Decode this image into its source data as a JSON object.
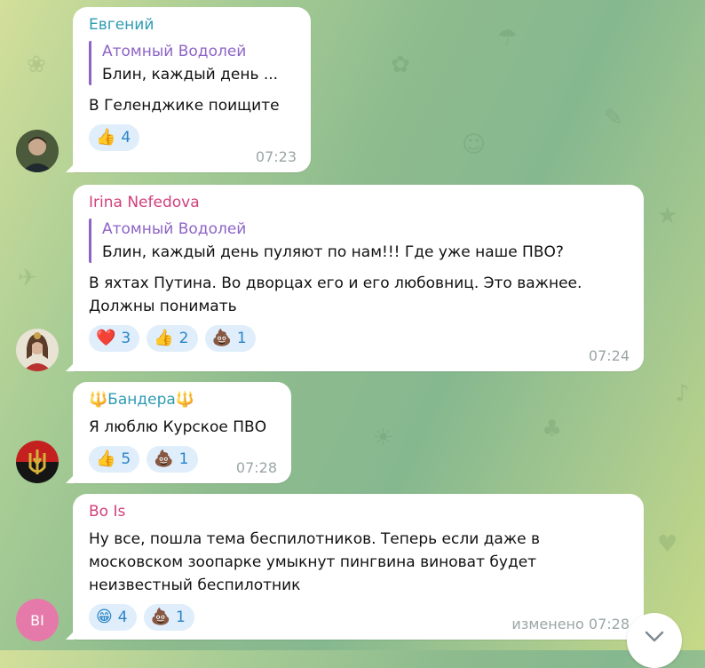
{
  "messages": [
    {
      "sender": "Евгений",
      "sender_color": "#2e9bb3",
      "quote": {
        "author": "Атомный Водолей",
        "text": "Блин,  каждый день ..."
      },
      "text_lines": [
        "В Геленджике поищите"
      ],
      "reactions": [
        {
          "emoji": "👍",
          "count": "4"
        }
      ],
      "time": "07:23"
    },
    {
      "sender": "Irina Nefedova",
      "sender_color": "#d0417c",
      "quote": {
        "author": "Атомный Водолей",
        "text": "Блин,  каждый день пуляют по нам!!! Где уже наше ПВО?"
      },
      "text_lines": [
        "В яхтах Путина. Во дворцах его и его любовниц. Это важнее.",
        "Должны понимать"
      ],
      "reactions": [
        {
          "emoji": "❤️",
          "count": "3"
        },
        {
          "emoji": "👍",
          "count": "2"
        },
        {
          "emoji": "💩",
          "count": "1"
        }
      ],
      "time": "07:24"
    },
    {
      "sender": "🔱Бандера🔱",
      "sender_color": "#2e9bb3",
      "text_lines": [
        "Я люблю Курское ПВО"
      ],
      "reactions": [
        {
          "emoji": "👍",
          "count": "5"
        },
        {
          "emoji": "💩",
          "count": "1"
        }
      ],
      "time": "07:28"
    },
    {
      "sender": "Bo Is",
      "sender_color": "#d0417c",
      "avatar_initials": "BI",
      "text_lines": [
        "Ну все, пошла тема беспилотников. Теперь если даже в",
        "московском зоопарке умыкнут пингвина виноват будет",
        "неизвестный беспилотник"
      ],
      "reactions": [
        {
          "emoji": "😁",
          "count": "4"
        },
        {
          "emoji": "💩",
          "count": "1"
        }
      ],
      "edited_label": "изменено",
      "time": "07:28"
    }
  ]
}
